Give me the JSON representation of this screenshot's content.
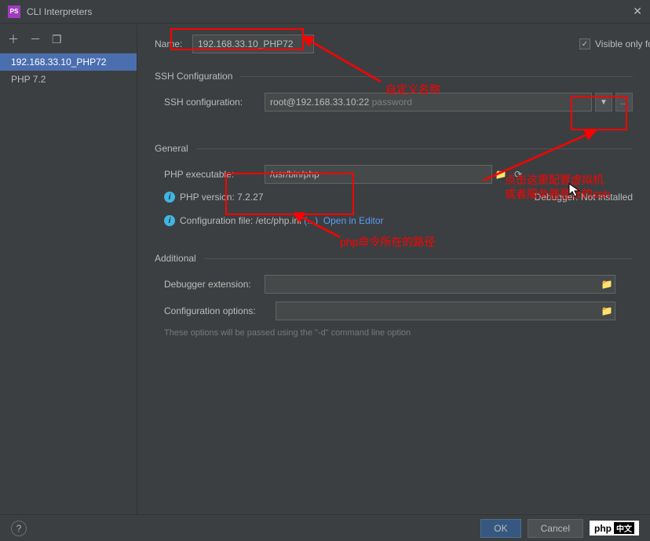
{
  "window": {
    "title": "CLI Interpreters",
    "app_icon_text": "PS"
  },
  "sidebar": {
    "items": [
      {
        "label": "192.168.33.10_PHP72",
        "selected": true
      },
      {
        "label": "PHP 7.2",
        "selected": false
      }
    ]
  },
  "name": {
    "label": "Name:",
    "value": "192.168.33.10_PHP72"
  },
  "visible_checkbox": {
    "label": "Visible only for this project",
    "checked": true
  },
  "ssh": {
    "section": "SSH Configuration",
    "config_label": "SSH configuration:",
    "user_host": "root@192.168.33.10:22",
    "auth": "password"
  },
  "general": {
    "section": "General",
    "exe_label": "PHP executable:",
    "exe_value": "/usr/bin/php",
    "version_label": "PHP version: 7.2.27",
    "debugger_label": "Debugger: Not installed",
    "config_file_label": "Configuration file: /etc/php.ini",
    "dots": "(...)",
    "open_editor": "Open in Editor"
  },
  "additional": {
    "section": "Additional",
    "debugger_ext_label": "Debugger extension:",
    "config_opts_label": "Configuration options:",
    "hint": "These options will be passed using the \"-d\" command line option"
  },
  "buttons": {
    "ok": "OK",
    "cancel": "Cancel"
  },
  "annotations": {
    "custom_name": "自定义名称",
    "ssh_hint_1": "点击这里配置虚拟机",
    "ssh_hint_2": "或者服务器登录的ssh",
    "php_path": "php命令所在的路径"
  },
  "php_badge": {
    "text": "php",
    "cn": "中文"
  }
}
